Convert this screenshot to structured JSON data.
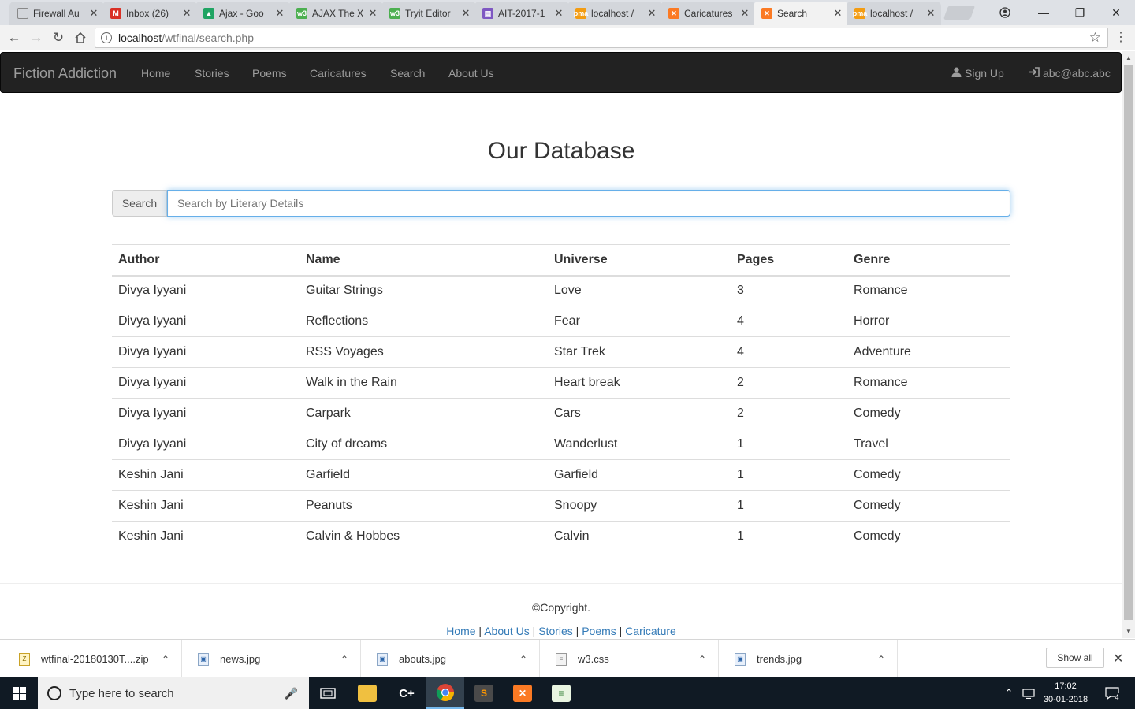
{
  "browser": {
    "tabs": [
      {
        "label": "Firewall Au",
        "icon": "page-icon",
        "color": "#888888",
        "glyph": ""
      },
      {
        "label": "Inbox (26)",
        "icon": "gmail-icon",
        "color": "#d93025",
        "glyph": "M"
      },
      {
        "label": "Ajax - Goo",
        "icon": "drive-icon",
        "color": "#1fa463",
        "glyph": "▲"
      },
      {
        "label": "AJAX The X",
        "icon": "w3schools-icon",
        "color": "#4caf50",
        "glyph": "w3"
      },
      {
        "label": "Tryit Editor",
        "icon": "w3schools-icon",
        "color": "#4caf50",
        "glyph": "w3"
      },
      {
        "label": "AIT-2017-1",
        "icon": "forms-icon",
        "color": "#7e57c2",
        "glyph": "▤"
      },
      {
        "label": "localhost /",
        "icon": "phpmyadmin-icon",
        "color": "#f39c12",
        "glyph": "pma"
      },
      {
        "label": "Caricatures",
        "icon": "xampp-icon",
        "color": "#fb7a24",
        "glyph": "✕"
      },
      {
        "label": "Search",
        "icon": "xampp-icon",
        "color": "#fb7a24",
        "glyph": "✕",
        "active": true
      },
      {
        "label": "localhost /",
        "icon": "phpmyadmin-icon",
        "color": "#f39c12",
        "glyph": "pma"
      }
    ],
    "url_host": "localhost",
    "url_path": "/wtfinal/search.php"
  },
  "site": {
    "brand": "Fiction Addiction",
    "nav": [
      "Home",
      "Stories",
      "Poems",
      "Caricatures",
      "Search",
      "About Us"
    ],
    "signup": "Sign Up",
    "account": "abc@abc.abc"
  },
  "main": {
    "title": "Our Database",
    "search_label": "Search",
    "search_placeholder": "Search by Literary Details",
    "search_value": ""
  },
  "table": {
    "headers": [
      "Author",
      "Name",
      "Universe",
      "Pages",
      "Genre"
    ],
    "rows": [
      [
        "Divya Iyyani",
        "Guitar Strings",
        "Love",
        "3",
        "Romance"
      ],
      [
        "Divya Iyyani",
        "Reflections",
        "Fear",
        "4",
        "Horror"
      ],
      [
        "Divya Iyyani",
        "RSS Voyages",
        "Star Trek",
        "4",
        "Adventure"
      ],
      [
        "Divya Iyyani",
        "Walk in the Rain",
        "Heart break",
        "2",
        "Romance"
      ],
      [
        "Divya Iyyani",
        "Carpark",
        "Cars",
        "2",
        "Comedy"
      ],
      [
        "Divya Iyyani",
        "City of dreams",
        "Wanderlust",
        "1",
        "Travel"
      ],
      [
        "Keshin Jani",
        "Garfield",
        "Garfield",
        "1",
        "Comedy"
      ],
      [
        "Keshin Jani",
        "Peanuts",
        "Snoopy",
        "1",
        "Comedy"
      ],
      [
        "Keshin Jani",
        "Calvin & Hobbes",
        "Calvin",
        "1",
        "Comedy"
      ]
    ]
  },
  "footer": {
    "copyright": "©Copyright.",
    "links": [
      "Home",
      "About Us",
      "Stories",
      "Poems",
      "Caricature"
    ]
  },
  "downloads": {
    "items": [
      "wtfinal-20180130T....zip",
      "news.jpg",
      "abouts.jpg",
      "w3.css",
      "trends.jpg"
    ],
    "show_all": "Show all"
  },
  "taskbar": {
    "search_text": "Type here to search",
    "time": "17:02",
    "date": "30-01-2018",
    "notification_count": "4"
  },
  "colors": {
    "navbar_bg": "#222222",
    "nav_text": "#9d9d9d",
    "link": "#337ab7",
    "focus_border": "#66afe9"
  }
}
